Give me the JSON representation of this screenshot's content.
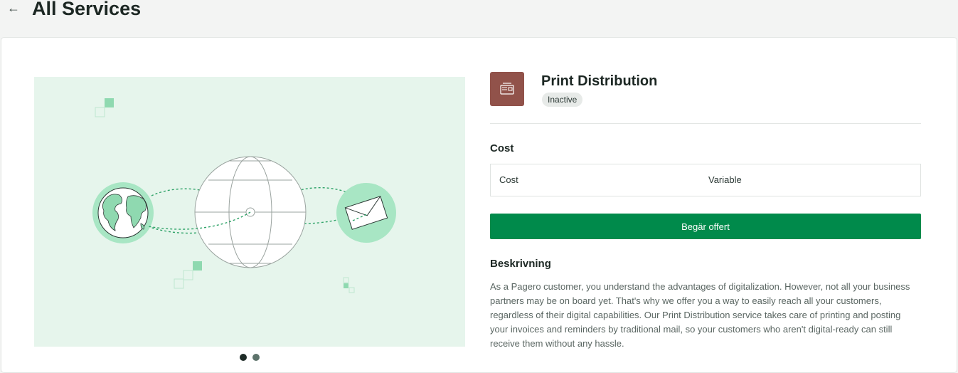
{
  "header": {
    "back_icon": "arrow-left-icon",
    "back_glyph": "←",
    "title": "All Services"
  },
  "carousel": {
    "slide_count": 2,
    "active_slide": 1,
    "illustration": "globe-network-illustration",
    "colors": {
      "background": "#e6f5ec",
      "accent": "#a8e6c4",
      "line": "#2fa368"
    }
  },
  "service": {
    "icon": "print-distribution-icon",
    "icon_color": "#91524a",
    "name": "Print Distribution",
    "status": "Inactive"
  },
  "cost": {
    "heading": "Cost",
    "rows": [
      {
        "label": "Cost",
        "value": "Variable"
      }
    ]
  },
  "actions": {
    "request_offer": "Begär offert",
    "color": "#008a4b"
  },
  "description": {
    "heading": "Beskrivning",
    "text": "As a Pagero customer, you understand the advantages of digitalization. However, not all your business partners may be on board yet. That's why we offer you a way to easily reach all your customers, regardless of their digital capabilities. Our Print Distribution service takes care of printing and posting your invoices and reminders by traditional mail, so your customers who aren't digital-ready can still receive them without any hassle."
  }
}
